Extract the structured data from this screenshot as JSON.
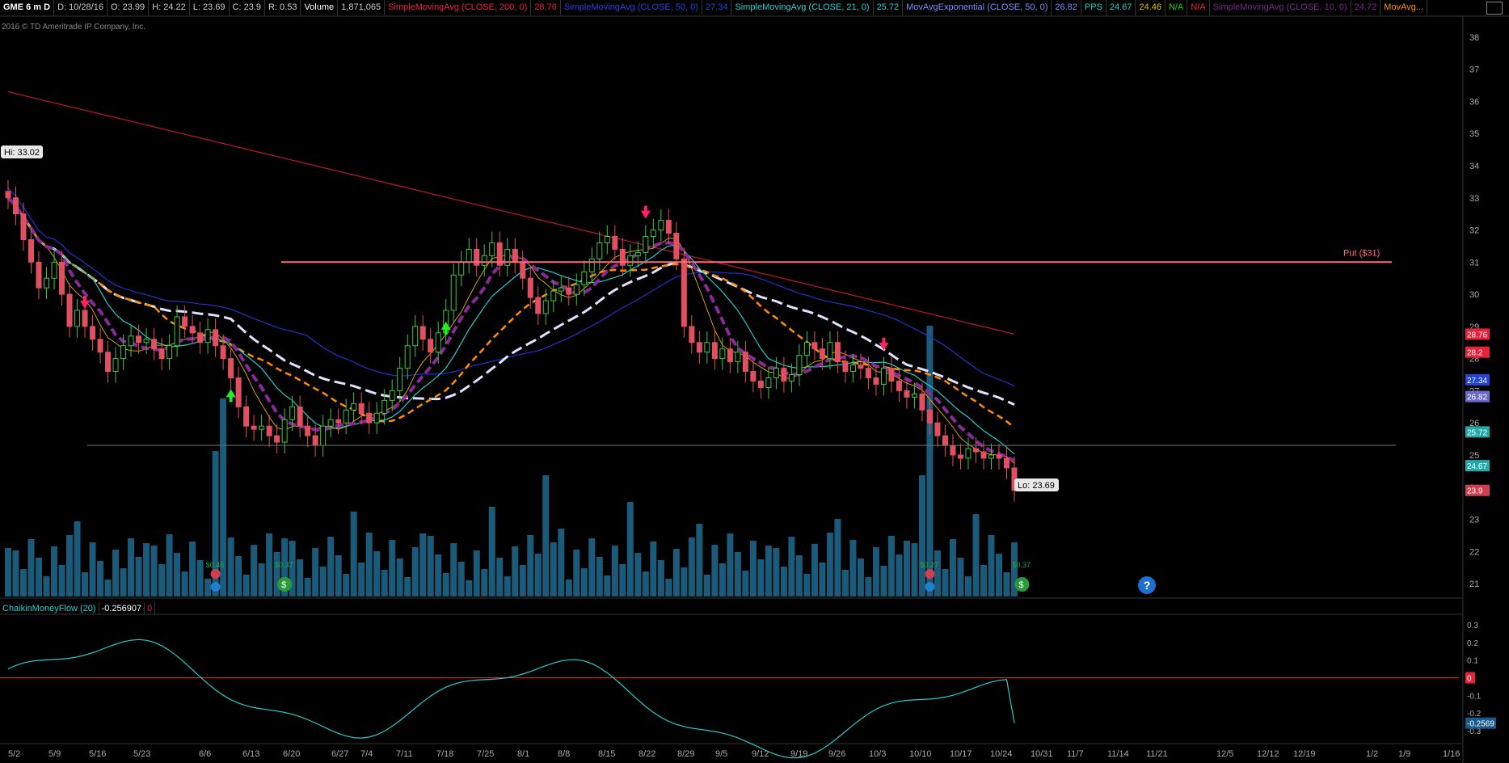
{
  "header": {
    "symbol": "GME 6 m D",
    "date": "D: 10/28/16",
    "open": "O: 23.99",
    "high": "H: 24.22",
    "low": "L: 23.69",
    "close": "C: 23.9",
    "range": "R: 0.53",
    "volume_label": "Volume",
    "volume_value": "1,871,065",
    "studies": [
      {
        "label": "SimpleMovingAvg (CLOSE, 200, 0)",
        "value": "28.76",
        "color": "#e8223a"
      },
      {
        "label": "SimpleMovingAvg (CLOSE, 50, 0)",
        "value": "27.34",
        "color": "#2244dd"
      },
      {
        "label": "SimpleMovingAvg (CLOSE, 21, 0)",
        "value": "25.72",
        "color": "#22cccc"
      },
      {
        "label": "MovAvgExponential (CLOSE, 50, 0)",
        "value": "26.82",
        "color": "#8888ff"
      },
      {
        "label": "PPS",
        "value": "24.67",
        "extra": "24.46",
        "extra2": "N/A",
        "extra3": "N/A",
        "color": "#22cccc"
      },
      {
        "label": "SimpleMovingAvg (CLOSE, 10, 0)",
        "value": "24.72",
        "color": "#7a2a8a"
      },
      {
        "label": "MovAvg...",
        "value": "",
        "color": "#ff8c00"
      }
    ]
  },
  "copyright": "2016 © TD Ameritrade IP Company, Inc.",
  "lower_panel": {
    "label": "ChaikinMoneyFlow (20)",
    "value": "-0.256907",
    "zero": "0"
  },
  "help_icon": "?",
  "chart_data": {
    "type": "candlestick",
    "price_axis": {
      "ticks": [
        21,
        22,
        23,
        24,
        25,
        26,
        27,
        28,
        29,
        30,
        31,
        32,
        33,
        34,
        35,
        36,
        37,
        38
      ],
      "ylim": [
        20.6,
        38.6
      ]
    },
    "x_labels": [
      "5/2",
      "5/9",
      "5/16",
      "5/23",
      "6/6",
      "6/13",
      "6/20",
      "6/27",
      "7/4",
      "7/11",
      "7/18",
      "7/25",
      "8/1",
      "8/8",
      "8/15",
      "8/22",
      "8/29",
      "9/5",
      "9/12",
      "9/19",
      "9/26",
      "10/3",
      "10/10",
      "10/17",
      "10/24",
      "10/31",
      "11/7",
      "11/14",
      "11/21",
      "12/5",
      "12/12",
      "12/19",
      "1/2",
      "1/9",
      "1/16"
    ],
    "closes": [
      33.0,
      32.5,
      31.7,
      31.0,
      30.2,
      30.5,
      31.0,
      30.0,
      29.0,
      29.5,
      29.0,
      28.6,
      28.2,
      27.6,
      28.0,
      28.4,
      28.7,
      28.5,
      28.6,
      28.3,
      28.0,
      28.4,
      29.3,
      29.0,
      28.8,
      28.5,
      28.9,
      28.4,
      28.0,
      27.4,
      26.5,
      25.9,
      25.8,
      25.9,
      25.6,
      25.4,
      26.1,
      26.5,
      25.9,
      25.6,
      25.3,
      25.9,
      26.1,
      26.0,
      26.4,
      26.6,
      26.3,
      26.0,
      26.3,
      26.7,
      27.0,
      27.7,
      28.4,
      29.0,
      28.6,
      28.2,
      28.8,
      29.5,
      30.6,
      31.0,
      31.4,
      30.9,
      31.2,
      31.6,
      30.9,
      31.4,
      31.0,
      30.5,
      29.9,
      29.4,
      29.8,
      30.1,
      30.2,
      30.0,
      30.3,
      30.7,
      31.1,
      31.6,
      31.8,
      31.4,
      30.9,
      31.2,
      31.3,
      31.8,
      32.0,
      32.3,
      31.9,
      31.1,
      29.0,
      28.5,
      28.2,
      28.5,
      28.0,
      28.3,
      27.9,
      28.2,
      27.6,
      27.3,
      27.1,
      27.4,
      27.7,
      27.3,
      27.5,
      28.1,
      28.5,
      28.3,
      28.0,
      28.5,
      27.9,
      27.6,
      27.8,
      27.7,
      27.4,
      27.2,
      27.7,
      27.3,
      27.0,
      26.8,
      26.9,
      26.4,
      26.0,
      25.6,
      25.3,
      25.0,
      24.9,
      25.2,
      25.1,
      24.9,
      25.0,
      24.9,
      24.6,
      23.9
    ],
    "hi_label": "Hi: 33.02",
    "lo_label": "Lo: 23.69",
    "put_label": "Put ($31)",
    "put_level": 31,
    "support_level": 25.3,
    "right_price_tags": [
      {
        "value": "28.76",
        "price": 28.76,
        "color": "#e8223a"
      },
      {
        "value": "28.2",
        "price": 28.2,
        "color": "#e8223a"
      },
      {
        "value": "27.34",
        "price": 27.34,
        "color": "#2244dd"
      },
      {
        "value": "26.82",
        "price": 26.82,
        "color": "#6a6acc"
      },
      {
        "value": "25.72",
        "price": 25.72,
        "color": "#22aaaa"
      },
      {
        "value": "24.67",
        "price": 24.67,
        "color": "#22aaaa"
      },
      {
        "value": "23.9",
        "price": 23.9,
        "color": "#d04050"
      }
    ],
    "events": [
      {
        "label": "$0.46",
        "bar": 27,
        "kind": "earnings"
      },
      {
        "label": "$0.37",
        "bar": 36,
        "kind": "dividend"
      },
      {
        "label": "$0.27",
        "bar": 120,
        "kind": "earnings"
      },
      {
        "label": "$0.37",
        "bar": 132,
        "kind": "dividend"
      }
    ],
    "cmf_axis": {
      "ticks": [
        0.3,
        0.2,
        0.1,
        -0.1,
        -0.2,
        -0.3
      ],
      "ylim": [
        -0.35,
        0.35
      ]
    },
    "cmf_value_tag": "-0.2569",
    "cmf_zero_tag": "0"
  }
}
